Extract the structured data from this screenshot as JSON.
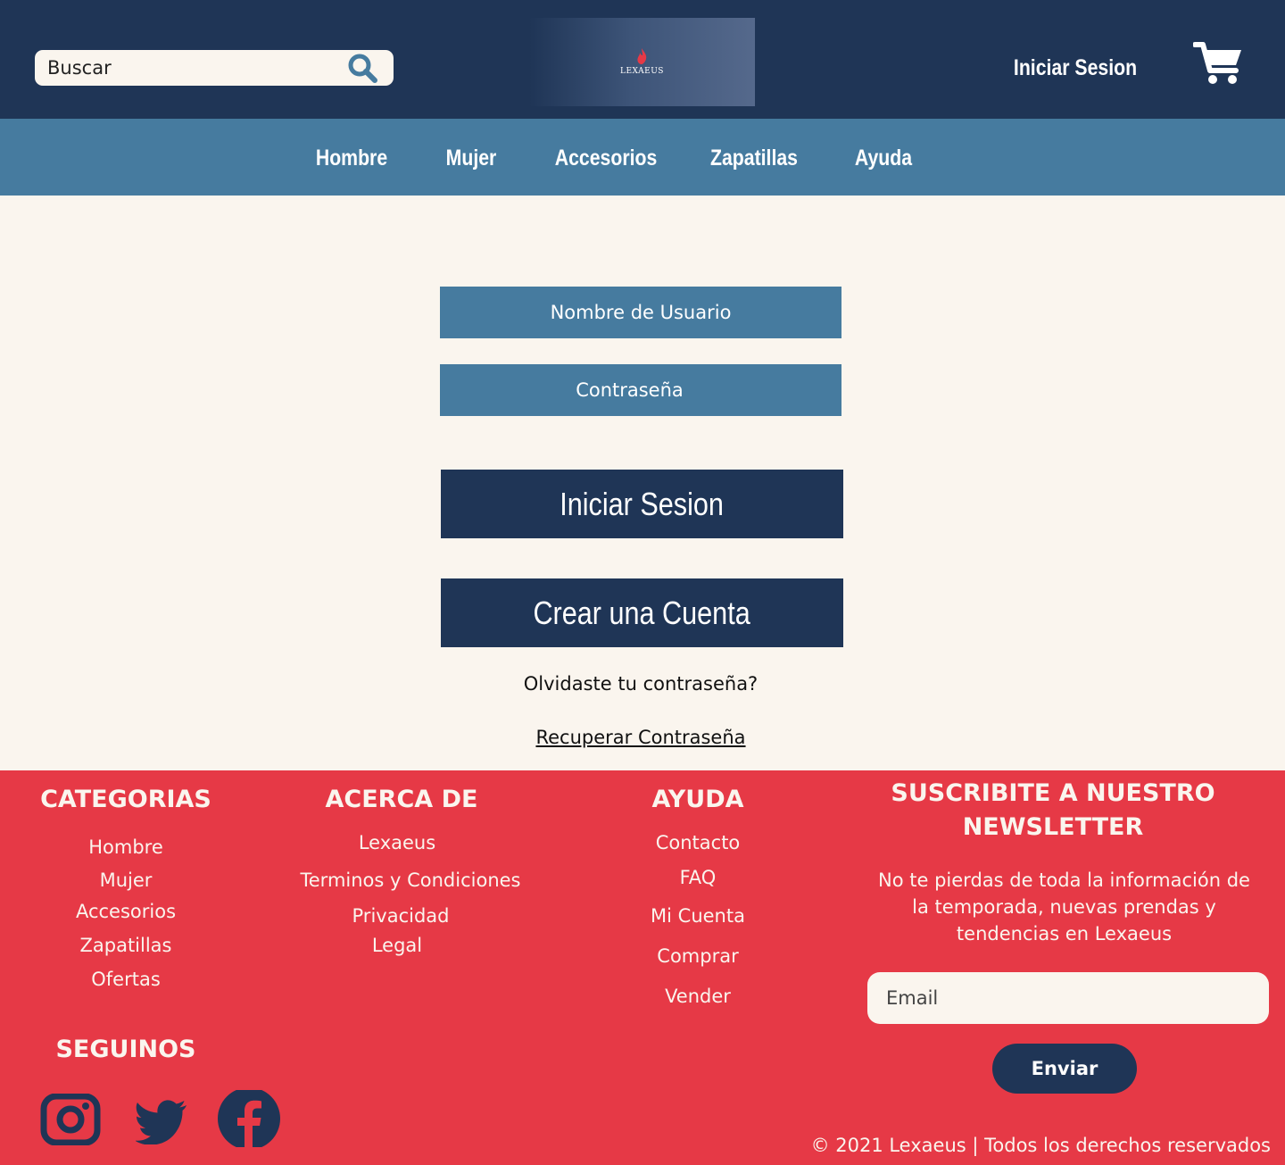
{
  "header": {
    "search": {
      "placeholder": "Buscar"
    },
    "logo": {
      "text": "LEXAEUS"
    },
    "login_label": "Iniciar Sesion"
  },
  "nav": {
    "items": [
      "Hombre",
      "Mujer",
      "Accesorios",
      "Zapatillas",
      "Ayuda"
    ]
  },
  "login": {
    "username_placeholder": "Nombre de Usuario",
    "password_placeholder": "Contraseña",
    "login_button": "Iniciar Sesion",
    "register_button": "Crear una Cuenta",
    "forgot_text": "Olvidaste tu contraseña?",
    "recover_link": "Recuperar Contraseña"
  },
  "footer": {
    "categorias": {
      "title": "CATEGORIAS",
      "items": [
        "Hombre",
        "Mujer",
        "Accesorios",
        "Zapatillas",
        "Ofertas"
      ]
    },
    "acerca": {
      "title": "ACERCA DE",
      "items": [
        "Lexaeus",
        "Terminos y Condiciones",
        "Privacidad",
        "Legal"
      ]
    },
    "ayuda": {
      "title": "AYUDA",
      "items": [
        "Contacto",
        "FAQ",
        "Mi Cuenta",
        "Comprar",
        "Vender"
      ]
    },
    "newsletter": {
      "title_line1": "SUSCRIBITE A NUESTRO",
      "title_line2": "NEWSLETTER",
      "desc_line1": "No te pierdas de toda la información de",
      "desc_line2": "la temporada, nuevas prendas y",
      "desc_line3": "tendencias en Lexaeus",
      "email_placeholder": "Email",
      "send_label": "Enviar"
    },
    "social": {
      "title": "SEGUINOS",
      "icons": [
        "instagram-icon",
        "twitter-icon",
        "facebook-icon"
      ]
    },
    "copyright": "© 2021 Lexaeus | Todos los derechos reservados"
  },
  "colors": {
    "navy": "#1f3556",
    "steel_blue": "#467b9f",
    "cream": "#faf5ee",
    "red": "#e63946"
  }
}
